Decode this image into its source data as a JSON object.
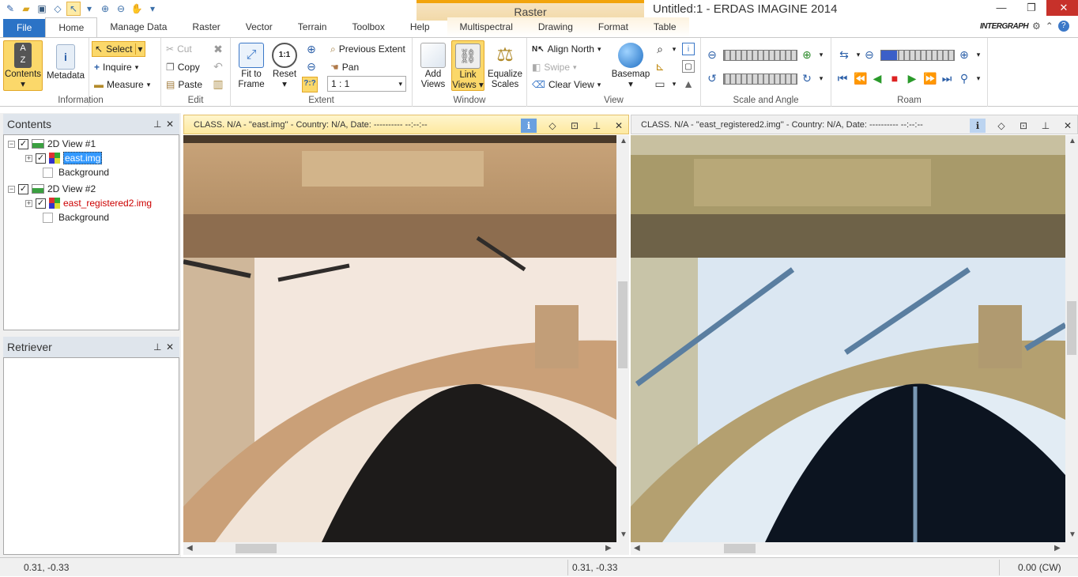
{
  "app": {
    "title": "Untitled:1 - ERDAS IMAGINE 2014",
    "context_tab": "Raster",
    "brand": "INTERGRAPH"
  },
  "tabs": [
    "File",
    "Home",
    "Manage Data",
    "Raster",
    "Vector",
    "Terrain",
    "Toolbox",
    "Help",
    "Multispectral",
    "Drawing",
    "Format",
    "Table"
  ],
  "ribbon": {
    "information": {
      "label": "Information",
      "contents": "Contents",
      "metadata": "Metadata"
    },
    "select": {
      "select": "Select",
      "inquire": "Inquire",
      "measure": "Measure"
    },
    "edit": {
      "label": "Edit",
      "cut": "Cut",
      "copy": "Copy",
      "paste": "Paste"
    },
    "extent": {
      "label": "Extent",
      "fit_line1": "Fit to",
      "fit_line2": "Frame",
      "reset": "Reset",
      "previous_extent": "Previous Extent",
      "pan": "Pan",
      "scale_value": "1 : 1"
    },
    "window": {
      "label": "Window",
      "add_line1": "Add",
      "add_line2": "Views",
      "link_line1": "Link",
      "link_line2": "Views",
      "eq_line1": "Equalize",
      "eq_line2": "Scales"
    },
    "view": {
      "label": "View",
      "align_north": "Align North",
      "swipe": "Swipe",
      "clear_view": "Clear View",
      "basemap": "Basemap"
    },
    "scale_angle": {
      "label": "Scale and Angle"
    },
    "roam": {
      "label": "Roam"
    }
  },
  "contents_panel": {
    "title": "Contents",
    "items": [
      {
        "label": "2D View #1"
      },
      {
        "label": "east.img"
      },
      {
        "label": "Background"
      },
      {
        "label": "2D View #2"
      },
      {
        "label": "east_registered2.img"
      },
      {
        "label": "Background"
      }
    ]
  },
  "retriever_panel": {
    "title": "Retriever"
  },
  "views": [
    {
      "header": "CLASS. N/A - ''east.img'' - Country: N/A, Date: ---------- --:--:--"
    },
    {
      "header": "CLASS. N/A - ''east_registered2.img'' - Country: N/A, Date: ---------- --:--:--"
    }
  ],
  "status": {
    "left_coord": "0.31, -0.33",
    "mid_coord": "0.31, -0.33",
    "rotation": "0.00 (CW)"
  },
  "colors": {
    "accent": "#2b73c6",
    "context": "#f2a40c",
    "close": "#c7312a",
    "selected_layer_bg": "#3399ff",
    "registered_layer_text": "#cc0000"
  }
}
